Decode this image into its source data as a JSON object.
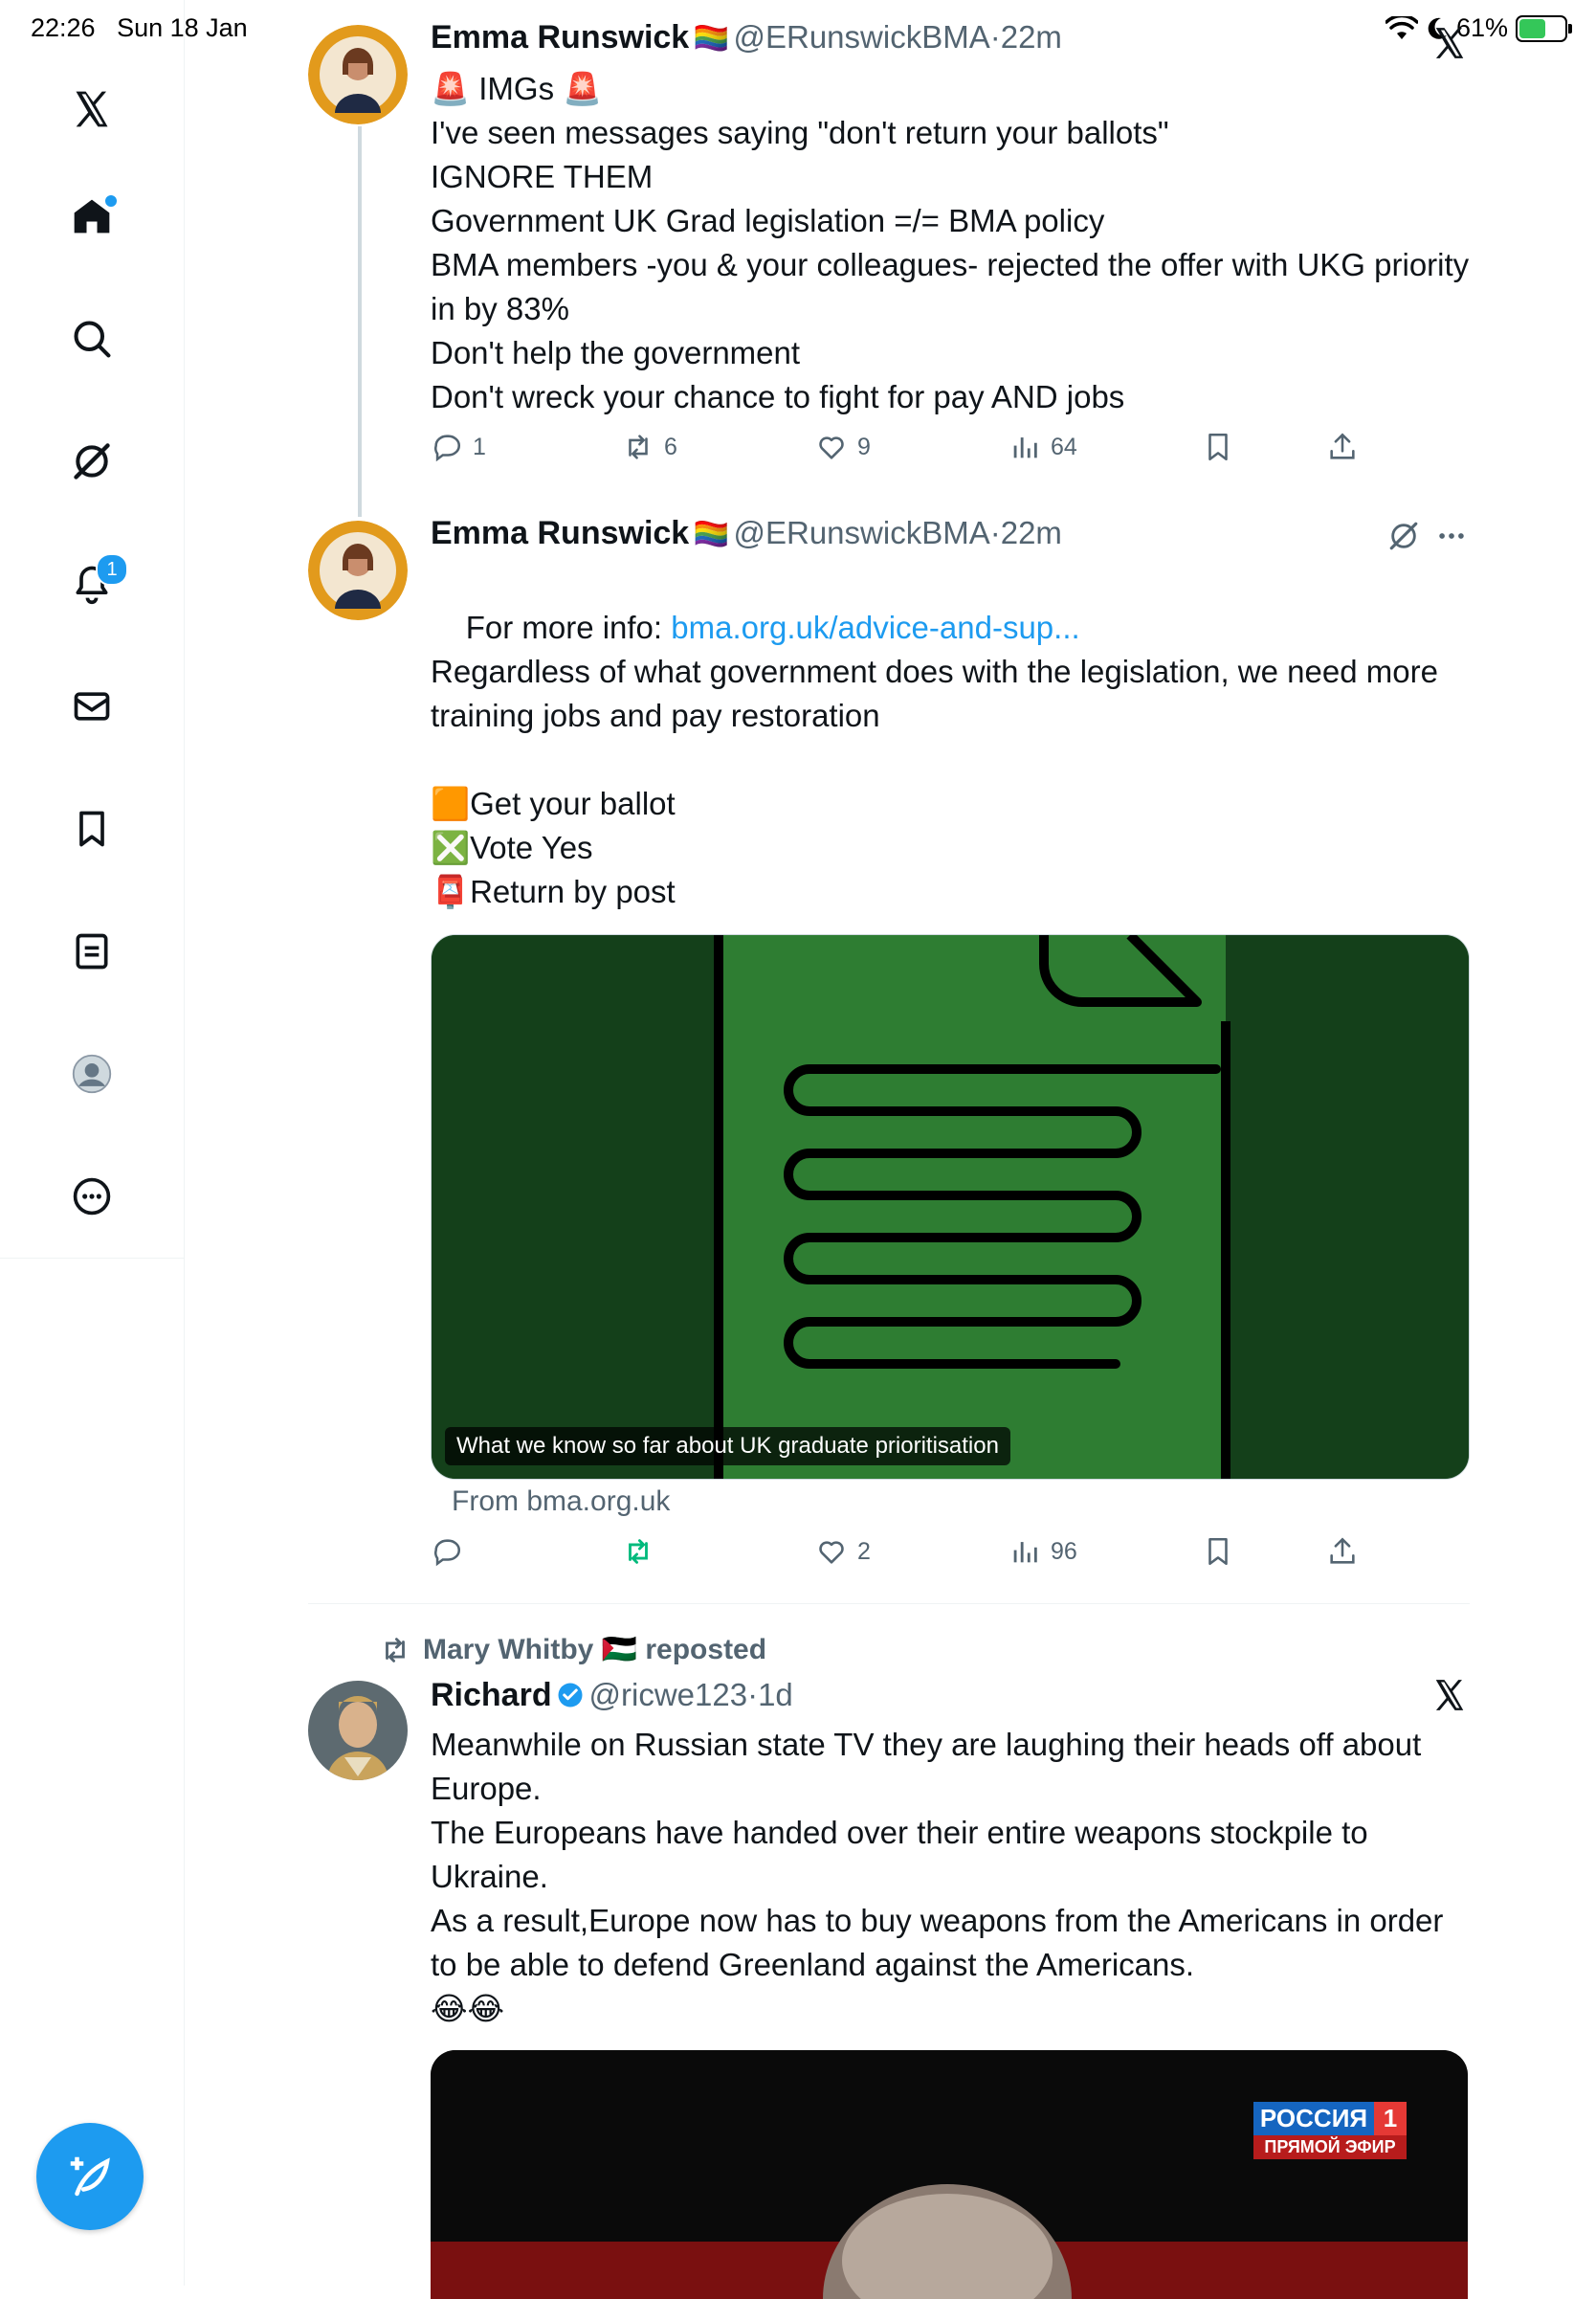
{
  "status_bar": {
    "time": "22:26",
    "date": "Sun 18 Jan",
    "battery": "61%",
    "battery_level": 0.61
  },
  "sidebar": {
    "notifications_badge": "1"
  },
  "colors": {
    "accent": "#1d9bf0",
    "text": "#0f1419",
    "muted": "#536471",
    "retweet_active": "#00ba7c"
  },
  "tweets": [
    {
      "name": "Emma Runswick",
      "flag": "🏳️‍🌈",
      "handle": "@ERunswickBMA",
      "sep": "·",
      "time": "22m",
      "text": "🚨 IMGs 🚨\nI've seen messages saying \"don't return your ballots\"\nIGNORE THEM\nGovernment UK Grad legislation =/= BMA policy\nBMA members -you & your colleagues- rejected the offer with UKG priority in by 83%\nDon't help the government\nDon't wreck your chance to fight for pay AND jobs",
      "replies": "1",
      "reposts": "6",
      "likes": "9",
      "views": "64"
    },
    {
      "name": "Emma Runswick",
      "flag": "🏳️‍🌈",
      "handle": "@ERunswickBMA",
      "sep": "·",
      "time": "22m",
      "text_prefix": "For more info: ",
      "link": "bma.org.uk/advice-and-sup...",
      "text": "Regardless of what government does with the legislation, we need more training jobs and pay restoration\n\n🟧Get your ballot\n❎Vote Yes\n📮Return by post",
      "card_caption": "What we know so far about UK graduate prioritisation",
      "card_from": "From bma.org.uk",
      "replies": "",
      "reposts": "",
      "likes": "2",
      "views": "96"
    },
    {
      "reposted_by": "Mary Whitby 🇵🇸 reposted",
      "name": "Richard",
      "handle": "@ricwe123",
      "sep": "·",
      "time": "1d",
      "text": "Meanwhile on Russian state TV they are laughing their heads off about Europe.\nThe Europeans have handed over their entire weapons stockpile to Ukraine.\nAs a result,Europe now has to buy weapons from the Americans in order to be able to defend Greenland against the Americans.\n😂😂",
      "video_logo_top": "РОССИЯ",
      "video_logo_num": "1",
      "video_logo_bottom": "ПРЯМОЙ ЭФИР"
    }
  ]
}
